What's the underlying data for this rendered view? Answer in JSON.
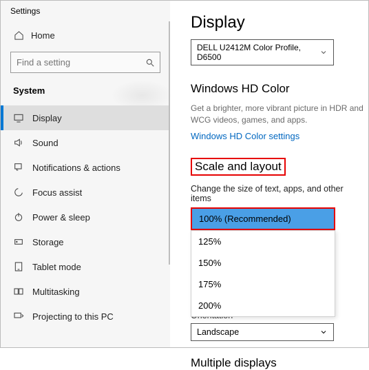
{
  "window": {
    "title": "Settings"
  },
  "sidebar": {
    "home": "Home",
    "search_placeholder": "Find a setting",
    "section": "System",
    "items": [
      {
        "label": "Display"
      },
      {
        "label": "Sound"
      },
      {
        "label": "Notifications & actions"
      },
      {
        "label": "Focus assist"
      },
      {
        "label": "Power & sleep"
      },
      {
        "label": "Storage"
      },
      {
        "label": "Tablet mode"
      },
      {
        "label": "Multitasking"
      },
      {
        "label": "Projecting to this PC"
      }
    ]
  },
  "main": {
    "title": "Display",
    "color_profile": "DELL U2412M Color Profile, D6500",
    "hd_color": {
      "heading": "Windows HD Color",
      "desc": "Get a brighter, more vibrant picture in HDR and WCG videos, games, and apps.",
      "link": "Windows HD Color settings"
    },
    "scale": {
      "heading": "Scale and layout",
      "label": "Change the size of text, apps, and other items",
      "selected": "100% (Recommended)",
      "options": [
        "125%",
        "150%",
        "175%",
        "200%"
      ]
    },
    "orientation": {
      "label_cut": "Orientation",
      "value": "Landscape"
    },
    "multiple": {
      "heading": "Multiple displays"
    }
  }
}
